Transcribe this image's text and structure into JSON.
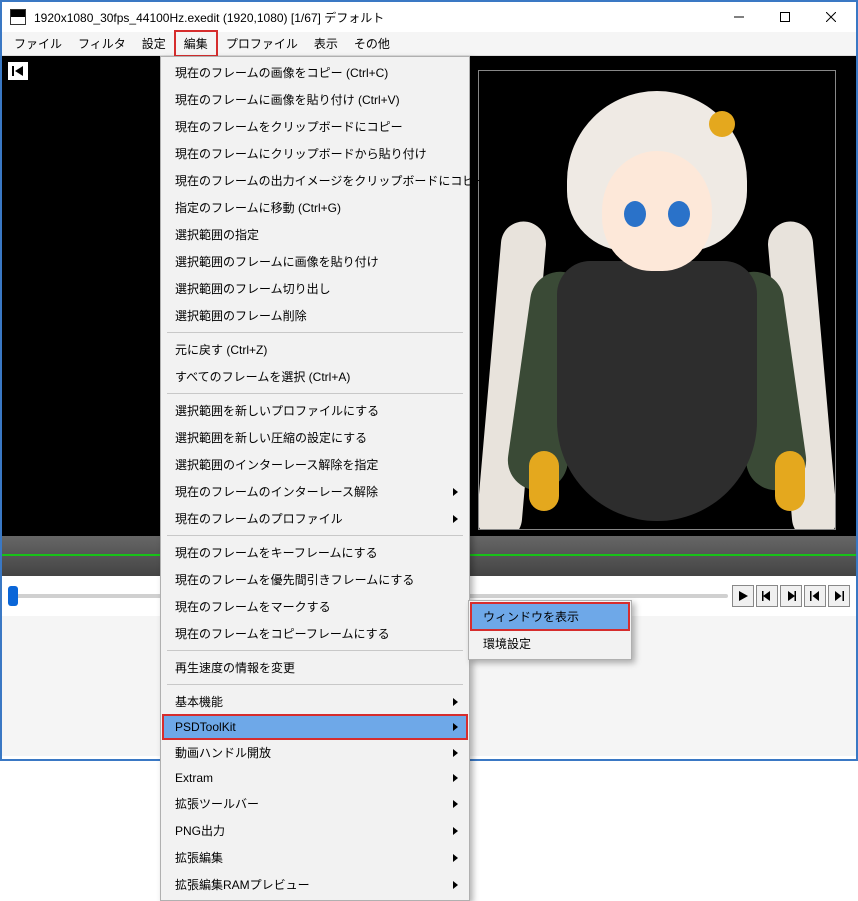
{
  "titlebar": {
    "text": "1920x1080_30fps_44100Hz.exedit (1920,1080)  [1/67]  デフォルト"
  },
  "menubar": {
    "items": [
      "ファイル",
      "フィルタ",
      "設定",
      "編集",
      "プロファイル",
      "表示",
      "その他"
    ],
    "highlighted_index": 3
  },
  "edit_menu": {
    "groups": [
      [
        {
          "label": "現在のフレームの画像をコピー (Ctrl+C)",
          "submenu": false
        },
        {
          "label": "現在のフレームに画像を貼り付け (Ctrl+V)",
          "submenu": false
        },
        {
          "label": "現在のフレームをクリップボードにコピー",
          "submenu": false
        },
        {
          "label": "現在のフレームにクリップボードから貼り付け",
          "submenu": false
        },
        {
          "label": "現在のフレームの出力イメージをクリップボードにコピー",
          "submenu": false
        },
        {
          "label": "指定のフレームに移動 (Ctrl+G)",
          "submenu": false
        },
        {
          "label": "選択範囲の指定",
          "submenu": false
        },
        {
          "label": "選択範囲のフレームに画像を貼り付け",
          "submenu": false
        },
        {
          "label": "選択範囲のフレーム切り出し",
          "submenu": false
        },
        {
          "label": "選択範囲のフレーム削除",
          "submenu": false
        }
      ],
      [
        {
          "label": "元に戻す (Ctrl+Z)",
          "submenu": false
        },
        {
          "label": "すべてのフレームを選択 (Ctrl+A)",
          "submenu": false
        }
      ],
      [
        {
          "label": "選択範囲を新しいプロファイルにする",
          "submenu": false
        },
        {
          "label": "選択範囲を新しい圧縮の設定にする",
          "submenu": false
        },
        {
          "label": "選択範囲のインターレース解除を指定",
          "submenu": false
        },
        {
          "label": "現在のフレームのインターレース解除",
          "submenu": true
        },
        {
          "label": "現在のフレームのプロファイル",
          "submenu": true
        }
      ],
      [
        {
          "label": "現在のフレームをキーフレームにする",
          "submenu": false
        },
        {
          "label": "現在のフレームを優先間引きフレームにする",
          "submenu": false
        },
        {
          "label": "現在のフレームをマークする",
          "submenu": false
        },
        {
          "label": "現在のフレームをコピーフレームにする",
          "submenu": false
        }
      ],
      [
        {
          "label": "再生速度の情報を変更",
          "submenu": false
        }
      ],
      [
        {
          "label": "基本機能",
          "submenu": true
        },
        {
          "label": "PSDToolKit",
          "submenu": true,
          "highlighted": true,
          "boxed": true
        },
        {
          "label": "動画ハンドル開放",
          "submenu": true
        },
        {
          "label": "Extram",
          "submenu": true
        },
        {
          "label": "拡張ツールバー",
          "submenu": true
        },
        {
          "label": "PNG出力",
          "submenu": true
        },
        {
          "label": "拡張編集",
          "submenu": true
        },
        {
          "label": "拡張編集RAMプレビュー",
          "submenu": true
        }
      ]
    ]
  },
  "submenu": {
    "items": [
      {
        "label": "ウィンドウを表示",
        "highlighted": true,
        "boxed": true
      },
      {
        "label": "環境設定",
        "highlighted": false
      }
    ]
  },
  "transport": {
    "buttons": [
      "play",
      "prev-frame",
      "next-frame",
      "first-frame",
      "last-frame"
    ]
  }
}
